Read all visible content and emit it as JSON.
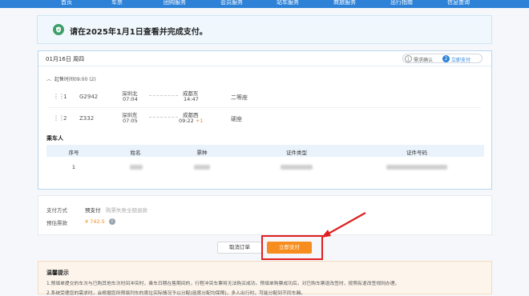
{
  "nav": {
    "items": [
      "首页",
      "车票",
      "团购服务",
      "会员服务",
      "站车服务",
      "商旅服务",
      "出行指南",
      "信息查询"
    ]
  },
  "notice": {
    "icon": "shield-check-icon",
    "text": "请在2025年1月1日查看并完成支付。"
  },
  "order": {
    "date": "01月16日 周四",
    "steps": [
      {
        "num": "1",
        "label": "需求确认"
      },
      {
        "num": "2",
        "label": "立即支付"
      }
    ],
    "group_title": "起售时间09:00 (2)",
    "trains": [
      {
        "idx": "1",
        "code": "G2942",
        "from_station": "深圳北",
        "from_time": "07:04",
        "to_station": "成都东",
        "to_time": "14:47",
        "day_offset": "",
        "seat": "二等座"
      },
      {
        "idx": "2",
        "code": "Z332",
        "from_station": "深圳东",
        "from_time": "07:05",
        "to_station": "成都西",
        "to_time": "09:22",
        "day_offset": "+1",
        "seat": "硬座"
      }
    ]
  },
  "passengers": {
    "title": "乘车人",
    "columns": [
      "序号",
      "姓名",
      "票种",
      "证件类型",
      "证件号码"
    ],
    "rows": [
      {
        "idx": "1"
      }
    ]
  },
  "payment": {
    "method_label": "支付方式",
    "method_value": "预支付",
    "method_hint": "购票失败全额退款",
    "amount_label": "预估票款",
    "amount_value": "¥ 742.5"
  },
  "actions": {
    "cancel_label": "取消订单",
    "pay_label": "立即支付"
  },
  "tips": {
    "title": "温馨提示",
    "lines": [
      "1.预填单提交的车次与已购其他车次时间冲突时，乘车日期在售期间的，行程冲突车票将无法购买成功。预填单购票成功后，对已购车票退改签时，按照有退改签规则办理。",
      "2.系统受理您的需求时，会根据您所预填列车的席位实际情况予以分配(座席分配均保障)，多人出行时，可能分配到不同车厢。"
    ]
  },
  "colors": {
    "accent": "#2d82d8",
    "pay_button": "#f78d1e",
    "highlight": "#e02020",
    "notice_icon": "#3fa06b"
  }
}
